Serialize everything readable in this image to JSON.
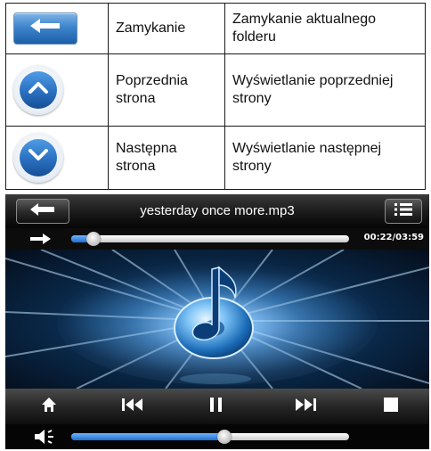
{
  "table": {
    "rows": [
      {
        "icon": "back-arrow-icon",
        "name": "Zamykanie",
        "description": "Zamykanie aktualnego folderu"
      },
      {
        "icon": "chevron-up-icon",
        "name": "Poprzednia strona",
        "description": "Wyświetlanie poprzedniej strony"
      },
      {
        "icon": "chevron-down-icon",
        "name": "Następna strona",
        "description": "Wyświetlanie następnej strony"
      }
    ]
  },
  "player": {
    "title": "yesterday once more.mp3",
    "time": "00:22/03:59",
    "progress": 0.08,
    "volume": 0.55,
    "icons": {
      "back": "back-arrow-icon",
      "playlist": "list-icon",
      "repeat": "arrow-right-icon",
      "home": "home-icon",
      "prev": "skip-previous-icon",
      "pause": "pause-icon",
      "next": "skip-next-icon",
      "stop": "stop-icon",
      "volume": "speaker-icon"
    }
  },
  "colors": {
    "accent": "#2a70c0",
    "progress_fill": "#1e6fd0"
  }
}
